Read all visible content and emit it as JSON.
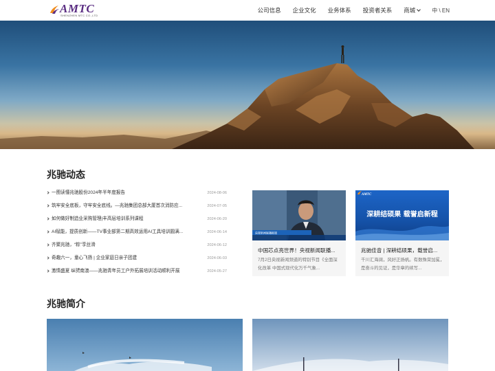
{
  "header": {
    "logo_text": "AMTC",
    "logo_sub": "SHENZHEN MTC CO.,LTD",
    "nav": [
      "公司信息",
      "企业文化",
      "业务体系",
      "投资者关系",
      "商城"
    ],
    "lang": "中 \\ EN"
  },
  "news": {
    "section_title": "兆驰动态",
    "items": [
      {
        "title": "一图读懂兆驰股份2024年半年度报告",
        "date": "2024-08-06"
      },
      {
        "title": "筑牢安全底板，守牢安全底线。—兆驰集团总部大厦首次消防应...",
        "date": "2024-07-05"
      },
      {
        "title": "如何做好制造业采购管理|丰高层培训系列课程",
        "date": "2024-06-20"
      },
      {
        "title": "AI赋能，提质创新——TV事业部第二期高效运用AI工具培训圆满...",
        "date": "2024-06-14"
      },
      {
        "title": "齐聚兆驰，“粽”享丝滑",
        "date": "2024-06-12"
      },
      {
        "title": "奇趣六一，童心飞扬 | 企业家庭日亲子团建",
        "date": "2024-06-03"
      },
      {
        "title": "激情盛夏 纵骋南澳——兆驰青年员工户外拓展培训活动顺利开展",
        "date": "2024-05-27"
      }
    ],
    "cards": [
      {
        "title": "中国芯点亮世界！央视新闻联播...",
        "desc": "7月2日央视新闻频道的特别节目《全面深化改革 中国式现代化万千气象...",
        "thumb_caption": "央视新闻联播报道"
      },
      {
        "title": "兆驰佳音 | 深耕结硕果，载誉启...",
        "desc": "千川汇海阔，风好正扬帆。有数殊荣加冕，是奋斗的见证，是华章的续写...",
        "thumb_logo": "AMTC",
        "thumb_text": "深耕结硕果  载誉启新程"
      }
    ]
  },
  "intro": {
    "section_title": "兆驰简介"
  },
  "colors": {
    "brand": "#5a2d82",
    "brand_accent": "#f08c1e",
    "card_blue": "#1c5fb5"
  }
}
